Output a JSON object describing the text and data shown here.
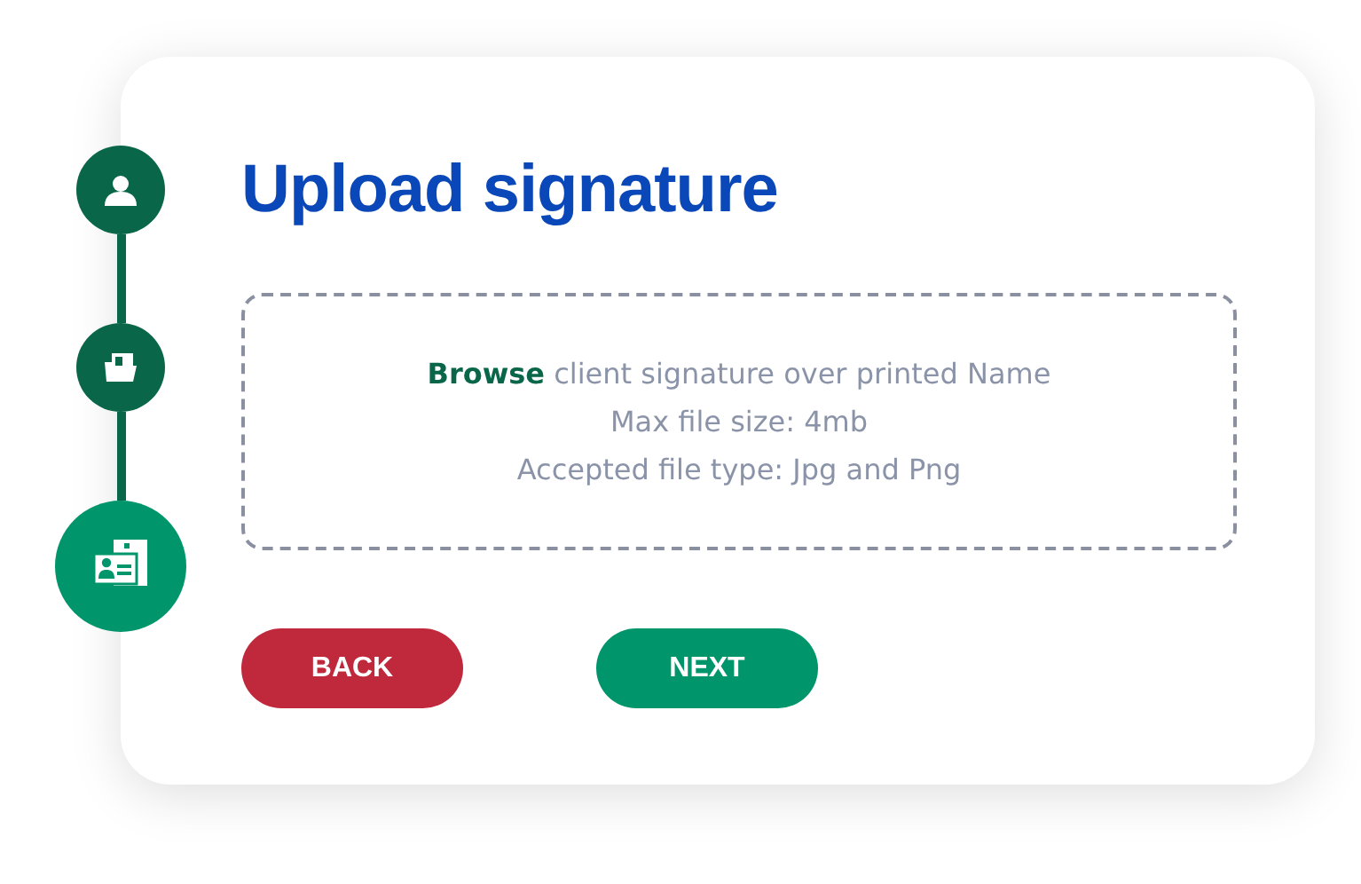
{
  "steps": [
    {
      "kind": "person",
      "selected": false
    },
    {
      "kind": "folder",
      "selected": false
    },
    {
      "kind": "id-card",
      "selected": true
    }
  ],
  "title": "Upload signature",
  "dropzone": {
    "browse_link": "Browse",
    "hint": "client signature over printed Name",
    "max_size": "Max file size: 4mb",
    "file_types": "Accepted file type: Jpg and Png"
  },
  "buttons": [
    {
      "kind": "back",
      "label": "BACK"
    },
    {
      "kind": "next",
      "label": "NEXT"
    }
  ]
}
